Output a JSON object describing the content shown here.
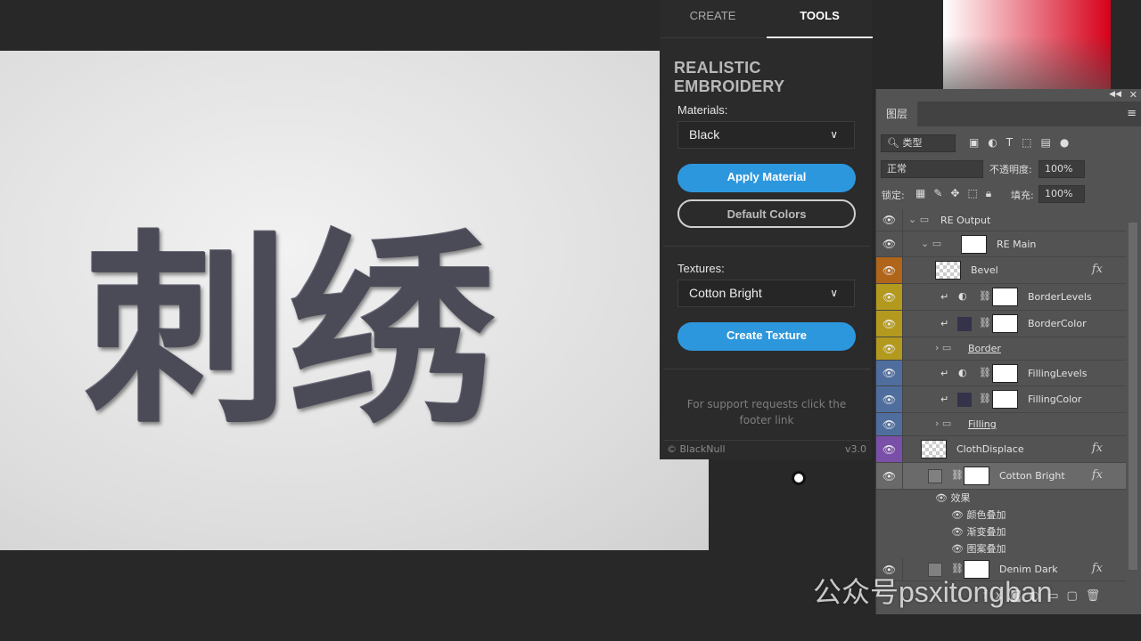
{
  "canvas": {
    "artwork_text": "刺绣"
  },
  "plugin": {
    "tabs": [
      {
        "label": "CREATE",
        "active": false
      },
      {
        "label": "TOOLS",
        "active": true
      }
    ],
    "title": "REALISTIC EMBROIDERY",
    "materials_label": "Materials:",
    "materials_value": "Black",
    "apply_material": "Apply Material",
    "default_colors": "Default Colors",
    "textures_label": "Textures:",
    "textures_value": "Cotton Bright",
    "create_texture": "Create Texture",
    "support_text": "For support requests click the footer link",
    "copyright": "© BlackNull",
    "version": "v3.0",
    "accent_color": "#2d97de"
  },
  "layers": {
    "tab": "图层",
    "filter_kind": "类型",
    "blend_mode": "正常",
    "opacity_label": "不透明度:",
    "opacity": "100%",
    "lock_label": "锁定:",
    "fill_label": "填充:",
    "fill": "100%",
    "rows": [
      {
        "name": "RE Output",
        "type": "group",
        "color": ""
      },
      {
        "name": "RE Main",
        "type": "group",
        "color": ""
      },
      {
        "name": "Bevel",
        "type": "smart",
        "color": "#b0651a",
        "fx": "fx"
      },
      {
        "name": "BorderLevels",
        "type": "adjust",
        "color": "#b39a1e"
      },
      {
        "name": "BorderColor",
        "type": "fill",
        "color": "#b39a1e"
      },
      {
        "name": "Border",
        "type": "folder",
        "color": "#b39a1e"
      },
      {
        "name": "FillingLevels",
        "type": "adjust",
        "color": "#4f6e9e"
      },
      {
        "name": "FillingColor",
        "type": "fill",
        "color": "#4f6e9e"
      },
      {
        "name": "Filling",
        "type": "folder",
        "color": "#4f6e9e"
      },
      {
        "name": "ClothDisplace",
        "type": "smart",
        "color": "#7a4fa8",
        "fx": "fx"
      },
      {
        "name": "Cotton Bright",
        "type": "layer",
        "color": "",
        "fx": "fx",
        "selected": true
      },
      {
        "name": "Denim Dark",
        "type": "layer",
        "color": "",
        "fx": "fx"
      }
    ],
    "effects_label": "效果",
    "effects": [
      "颜色叠加",
      "渐变叠加",
      "图案叠加"
    ]
  },
  "watermark": "公众号psxitongban"
}
